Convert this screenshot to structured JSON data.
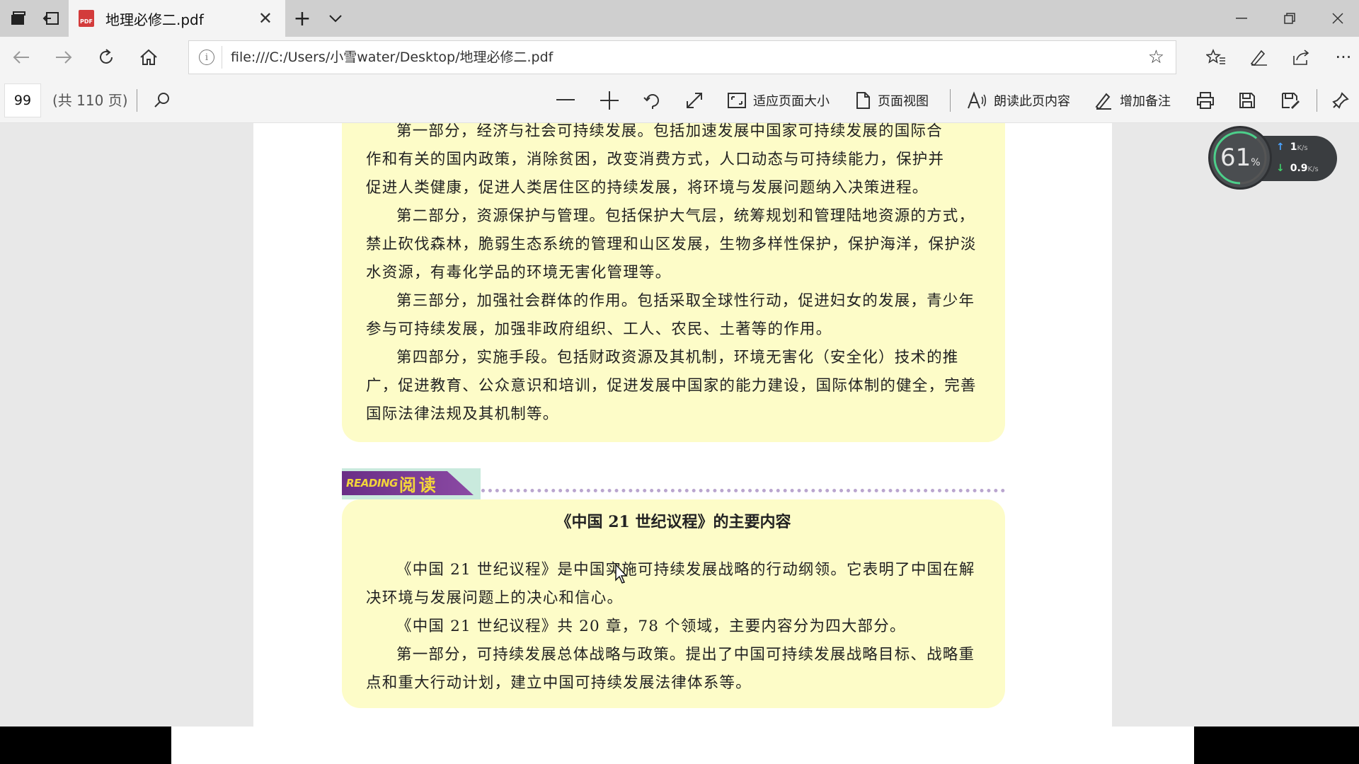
{
  "tab": {
    "title": "地理必修二.pdf",
    "file_type_icon": "pdf-icon",
    "file_type_label": "PDF"
  },
  "address": {
    "url": "file:///C:/Users/小雪water/Desktop/地理必修二.pdf"
  },
  "pdf_toolbar": {
    "current_page": "99",
    "total_pages_label": "(共 110 页)",
    "fit_page_label": "适应页面大小",
    "page_view_label": "页面视图",
    "read_aloud_label": "朗读此页内容",
    "add_notes_label": "增加备注"
  },
  "network_monitor": {
    "percent": "61",
    "percent_symbol": "%",
    "upload": "1",
    "upload_unit": "K/s",
    "download": "0.9",
    "download_unit": "K/s"
  },
  "document": {
    "box1_lines": [
      "第一部分，经济与社会可持续发展。包括加速发展中国家可持续发展的国际合",
      "作和有关的国内政策，消除贫困，改变消费方式，人口动态与可持续能力，保护并",
      "促进人类健康，促进人类居住区的持续发展，将环境与发展问题纳入决策进程。"
    ],
    "box1_paragraphs": [
      "第二部分，资源保护与管理。包括保护大气层，统筹规划和管理陆地资源的方式，禁止砍伐森林，脆弱生态系统的管理和山区发展，生物多样性保护，保护海洋，保护淡水资源，有毒化学品的环境无害化管理等。",
      "第三部分，加强社会群体的作用。包括采取全球性行动，促进妇女的发展，青少年参与可持续发展，加强非政府组织、工人、农民、土著等的作用。",
      "第四部分，实施手段。包括财政资源及其机制，环境无害化（安全化）技术的推广，促进教育、公众意识和培训，促进发展中国家的能力建设，国际体制的健全，完善国际法律法规及其机制等。"
    ],
    "reading_label_en": "READING",
    "reading_label_zh": "阅读",
    "box2_title": "《中国 21 世纪议程》的主要内容",
    "box2_paragraphs": [
      "《中国 21 世纪议程》是中国实施可持续发展战略的行动纲领。它表明了中国在解决环境与发展问题上的决心和信心。",
      "《中国 21 世纪议程》共 20 章，78 个领域，主要内容分为四大部分。",
      "第一部分，可持续发展总体战略与政策。提出了中国可持续发展战略目标、战略重点和重大行动计划，建立中国可持续发展法律体系等。"
    ]
  }
}
